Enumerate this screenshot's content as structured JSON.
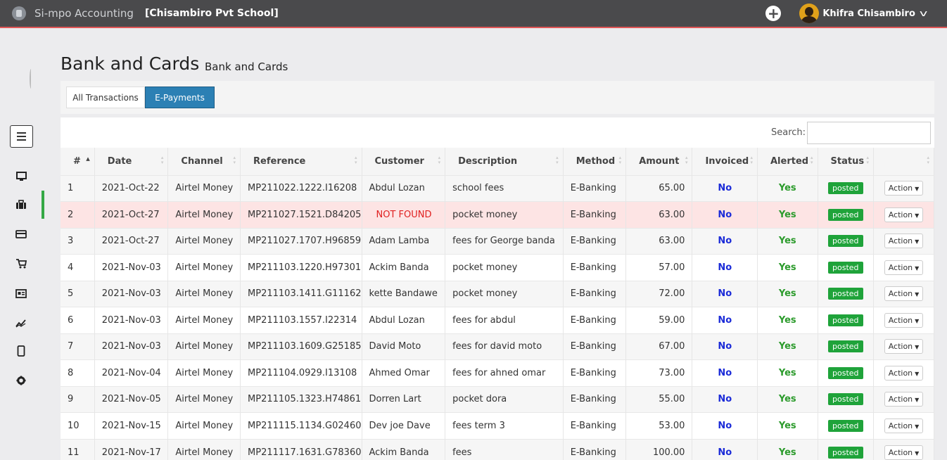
{
  "app": {
    "name": "Si-mpo Accounting",
    "company": "[Chisambiro Pvt School]"
  },
  "user": {
    "name": "Khifra Chisambiro"
  },
  "page": {
    "title": "Bank and Cards",
    "subtitle": "Bank and Cards"
  },
  "tabs": [
    {
      "label": "All Transactions"
    },
    {
      "label": "E-Payments"
    }
  ],
  "search": {
    "label": "Search:",
    "value": ""
  },
  "table": {
    "columns": [
      "#",
      "Date",
      "Channel",
      "Reference",
      "Customer",
      "Description",
      "Method",
      "Amount",
      "Invoiced",
      "Alerted",
      "Status",
      ""
    ],
    "rows": [
      {
        "n": "1",
        "date": "2021-Oct-22",
        "channel": "Airtel Money",
        "ref": "MP211022.1222.I16208",
        "customer": "Abdul Lozan",
        "desc": "school fees",
        "method": "E-Banking",
        "amount": "65.00",
        "invoiced": "No",
        "alerted": "Yes",
        "status": "posted",
        "action": "Action"
      },
      {
        "n": "2",
        "date": "2021-Oct-27",
        "channel": "Airtel Money",
        "ref": "MP211027.1521.D84205",
        "customer": "NOT FOUND",
        "desc": "pocket money",
        "method": "E-Banking",
        "amount": "63.00",
        "invoiced": "No",
        "alerted": "Yes",
        "status": "posted",
        "action": "Action"
      },
      {
        "n": "3",
        "date": "2021-Oct-27",
        "channel": "Airtel Money",
        "ref": "MP211027.1707.H96859",
        "customer": "Adam Lamba",
        "desc": "fees for George banda",
        "method": "E-Banking",
        "amount": "63.00",
        "invoiced": "No",
        "alerted": "Yes",
        "status": "posted",
        "action": "Action"
      },
      {
        "n": "4",
        "date": "2021-Nov-03",
        "channel": "Airtel Money",
        "ref": "MP211103.1220.H97301",
        "customer": "Ackim Banda",
        "desc": "pocket money",
        "method": "E-Banking",
        "amount": "57.00",
        "invoiced": "No",
        "alerted": "Yes",
        "status": "posted",
        "action": "Action"
      },
      {
        "n": "5",
        "date": "2021-Nov-03",
        "channel": "Airtel Money",
        "ref": "MP211103.1411.G11162",
        "customer": "kette Bandawe",
        "desc": "pocket money",
        "method": "E-Banking",
        "amount": "72.00",
        "invoiced": "No",
        "alerted": "Yes",
        "status": "posted",
        "action": "Action"
      },
      {
        "n": "6",
        "date": "2021-Nov-03",
        "channel": "Airtel Money",
        "ref": "MP211103.1557.I22314",
        "customer": "Abdul Lozan",
        "desc": "fees for abdul",
        "method": "E-Banking",
        "amount": "59.00",
        "invoiced": "No",
        "alerted": "Yes",
        "status": "posted",
        "action": "Action"
      },
      {
        "n": "7",
        "date": "2021-Nov-03",
        "channel": "Airtel Money",
        "ref": "MP211103.1609.G25185",
        "customer": "David Moto",
        "desc": "fees for david moto",
        "method": "E-Banking",
        "amount": "67.00",
        "invoiced": "No",
        "alerted": "Yes",
        "status": "posted",
        "action": "Action"
      },
      {
        "n": "8",
        "date": "2021-Nov-04",
        "channel": "Airtel Money",
        "ref": "MP211104.0929.I13108",
        "customer": "Ahmed Omar",
        "desc": "fees for ahned omar",
        "method": "E-Banking",
        "amount": "73.00",
        "invoiced": "No",
        "alerted": "Yes",
        "status": "posted",
        "action": "Action"
      },
      {
        "n": "9",
        "date": "2021-Nov-05",
        "channel": "Airtel Money",
        "ref": "MP211105.1323.H74861",
        "customer": "Dorren Lart",
        "desc": "pocket dora",
        "method": "E-Banking",
        "amount": "55.00",
        "invoiced": "No",
        "alerted": "Yes",
        "status": "posted",
        "action": "Action"
      },
      {
        "n": "10",
        "date": "2021-Nov-15",
        "channel": "Airtel Money",
        "ref": "MP211115.1134.G02460",
        "customer": "Dev joe Dave",
        "desc": "fees term 3",
        "method": "E-Banking",
        "amount": "53.00",
        "invoiced": "No",
        "alerted": "Yes",
        "status": "posted",
        "action": "Action"
      },
      {
        "n": "11",
        "date": "2021-Nov-17",
        "channel": "Airtel Money",
        "ref": "MP211117.1631.G78360",
        "customer": "Ackim Banda",
        "desc": "fees",
        "method": "E-Banking",
        "amount": "100.00",
        "invoiced": "No",
        "alerted": "Yes",
        "status": "posted",
        "action": "Action"
      }
    ]
  },
  "icons": {
    "sidebar": [
      "monitor-icon",
      "briefcase-icon",
      "credit-card-icon",
      "cart-icon",
      "id-card-icon",
      "chart-line-icon",
      "mobile-icon",
      "gear-icon"
    ]
  },
  "colors": {
    "accent": "#2c80b4",
    "success": "#1fa33a",
    "danger": "#e02020",
    "topbar": "#4a4a4c"
  }
}
